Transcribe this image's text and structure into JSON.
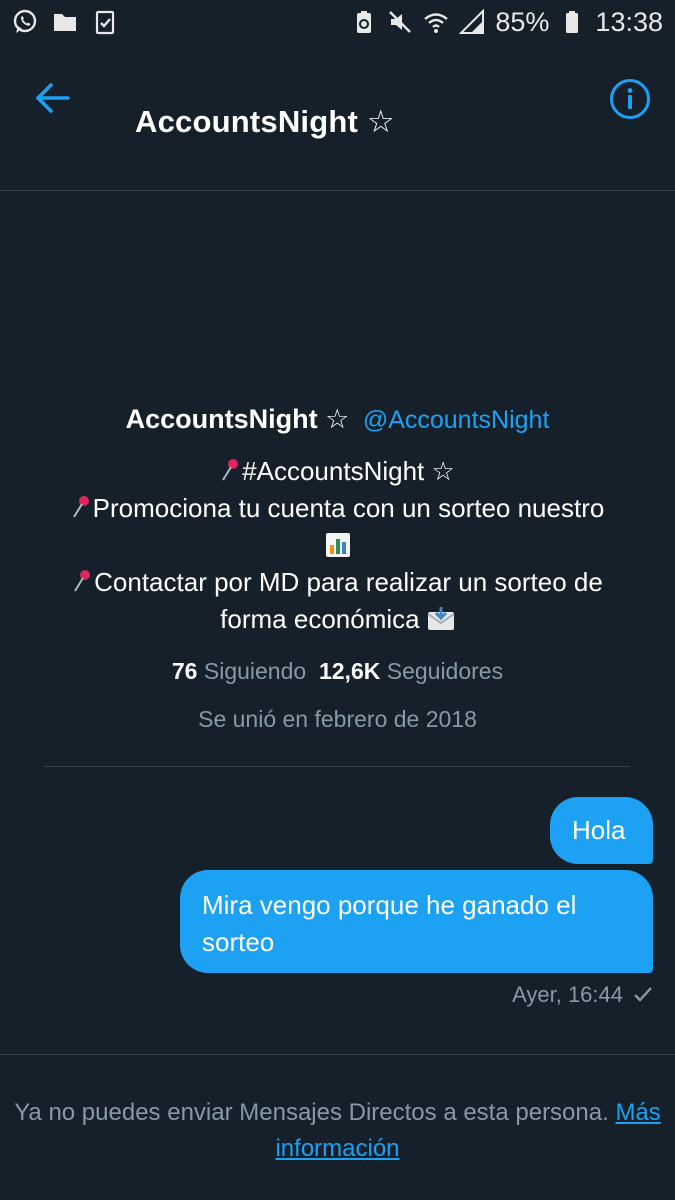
{
  "status_bar": {
    "battery": "85%",
    "time": "13:38"
  },
  "header": {
    "title": "AccountsNight ☆"
  },
  "profile": {
    "name": "AccountsNight ☆",
    "handle": "@AccountsNight",
    "bio_lines": [
      "#AccountsNight ☆",
      "Promociona tu cuenta con un sorteo nuestro",
      "Contactar por MD para realizar un sorteo de",
      "forma económica"
    ],
    "following_count": "76",
    "following_label": "Siguiendo",
    "followers_count": "12,6K",
    "followers_label": "Seguidores",
    "joined": "Se unió en febrero de 2018"
  },
  "messages": [
    {
      "text": "Hola"
    },
    {
      "text": "Mira vengo porque he ganado el sorteo"
    }
  ],
  "message_timestamp": "Ayer, 16:44",
  "footer": {
    "notice": "Ya no puedes enviar Mensajes Directos a esta persona.",
    "link": "Más información"
  },
  "colors": {
    "background": "#16202b",
    "accent": "#1da1f2",
    "muted_text": "#8899a6",
    "divider": "#38444d"
  },
  "icons": [
    "whatsapp-icon",
    "folder-icon",
    "clipboard-check-icon",
    "battery-saver-icon",
    "mute-icon",
    "wifi-icon",
    "signal-icon",
    "battery-icon",
    "back-arrow-icon",
    "info-icon",
    "pushpin-icon",
    "bar-chart-icon",
    "envelope-inbox-icon",
    "check-icon"
  ]
}
